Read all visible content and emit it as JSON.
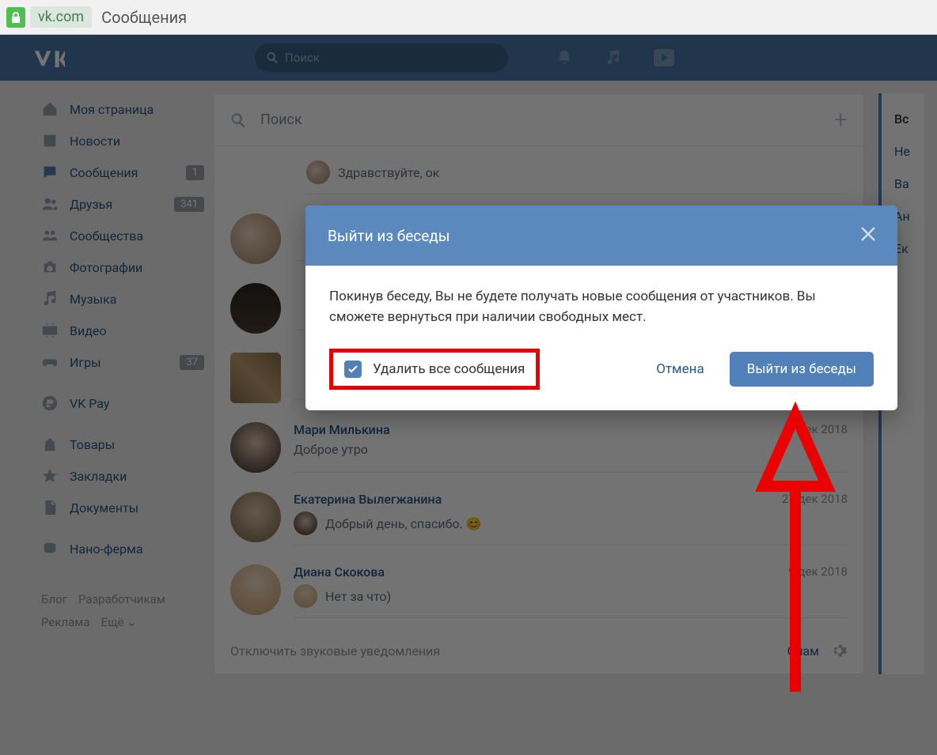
{
  "browser": {
    "domain": "vk.com",
    "page_title": "Сообщения"
  },
  "header": {
    "search_placeholder": "Поиск"
  },
  "sidebar": {
    "items": [
      {
        "label": "Моя страница",
        "badge": ""
      },
      {
        "label": "Новости",
        "badge": ""
      },
      {
        "label": "Сообщения",
        "badge": "1"
      },
      {
        "label": "Друзья",
        "badge": "341"
      },
      {
        "label": "Сообщества",
        "badge": ""
      },
      {
        "label": "Фотографии",
        "badge": ""
      },
      {
        "label": "Музыка",
        "badge": ""
      },
      {
        "label": "Видео",
        "badge": ""
      },
      {
        "label": "Игры",
        "badge": "37"
      },
      {
        "label": "VK Pay",
        "badge": ""
      },
      {
        "label": "Товары",
        "badge": ""
      },
      {
        "label": "Закладки",
        "badge": ""
      },
      {
        "label": "Документы",
        "badge": ""
      },
      {
        "label": "Нано-ферма",
        "badge": ""
      }
    ],
    "footer": [
      "Блог",
      "Разработчикам",
      "Реклама",
      "Ещё ⌄"
    ]
  },
  "main": {
    "search_placeholder": "Поиск",
    "convs": [
      {
        "name": "",
        "text": "Здравствуйте, ок",
        "date": ""
      },
      {
        "name": "",
        "text": "",
        "date": ""
      },
      {
        "name": "",
        "text": "",
        "date": ""
      },
      {
        "name": "",
        "text": "",
        "date": ""
      },
      {
        "name": "Мари Милькина",
        "text": "Доброе утро",
        "date": "9 дек 2018"
      },
      {
        "name": "Екатерина Вылегжанина",
        "text": "Добрый день, спасибо. 😊",
        "date": "27 дек 2018"
      },
      {
        "name": "Диана Скокова",
        "text": "Нет за что)",
        "date": "9 дек 2018"
      }
    ],
    "mute": "Отключить звуковые уведомления",
    "spam": "Спам"
  },
  "right": {
    "items": [
      "Вс",
      "Не",
      "Ва",
      "Ан",
      "Ек"
    ]
  },
  "modal": {
    "title": "Выйти из беседы",
    "body": "Покинув беседу, Вы не будете получать новые сообщения от участников. Вы сможете вернуться при наличии свободных мест.",
    "checkbox_label": "Удалить все сообщения",
    "cancel": "Отмена",
    "confirm": "Выйти из беседы"
  }
}
